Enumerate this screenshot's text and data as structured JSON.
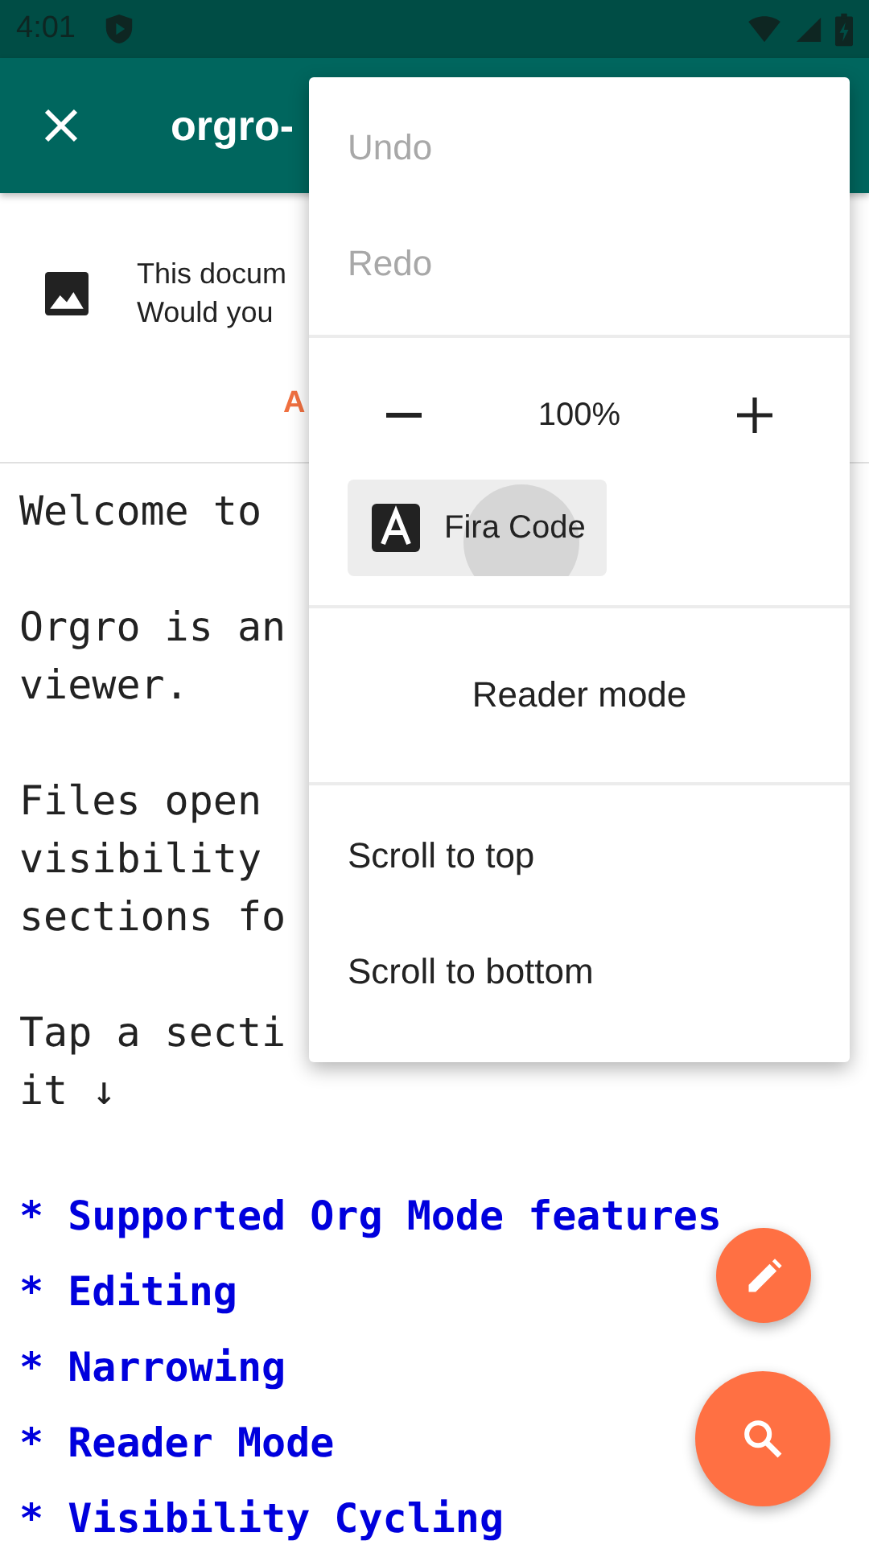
{
  "status_bar": {
    "time": "4:01"
  },
  "app_bar": {
    "title": "orgro-"
  },
  "banner": {
    "lines": [
      "This docum",
      "Would you"
    ],
    "action": "A"
  },
  "document": {
    "paragraphs": [
      {
        "lines": [
          "Welcome to"
        ]
      },
      {
        "lines": [
          "Orgro is an",
          "viewer."
        ]
      },
      {
        "lines": [
          "Files open",
          "visibility",
          "sections fo"
        ]
      },
      {
        "lines": [
          "Tap a secti",
          "it ↓"
        ]
      }
    ],
    "headings": [
      "* Supported Org Mode features",
      "* Editing",
      "* Narrowing",
      "* Reader Mode",
      "* Visibility Cycling"
    ]
  },
  "menu": {
    "sections": [
      {
        "kind": "items",
        "items": [
          {
            "label": "Undo",
            "disabled": true
          },
          {
            "label": "Redo",
            "disabled": true
          }
        ]
      },
      {
        "kind": "zoom",
        "value": "100%",
        "font": {
          "label": "Fira Code",
          "pressed": true
        }
      },
      {
        "kind": "centered",
        "items": [
          {
            "label": "Reader mode",
            "disabled": false
          }
        ]
      },
      {
        "kind": "items",
        "items": [
          {
            "label": "Scroll to top",
            "disabled": false
          },
          {
            "label": "Scroll to bottom",
            "disabled": false
          }
        ]
      }
    ]
  }
}
